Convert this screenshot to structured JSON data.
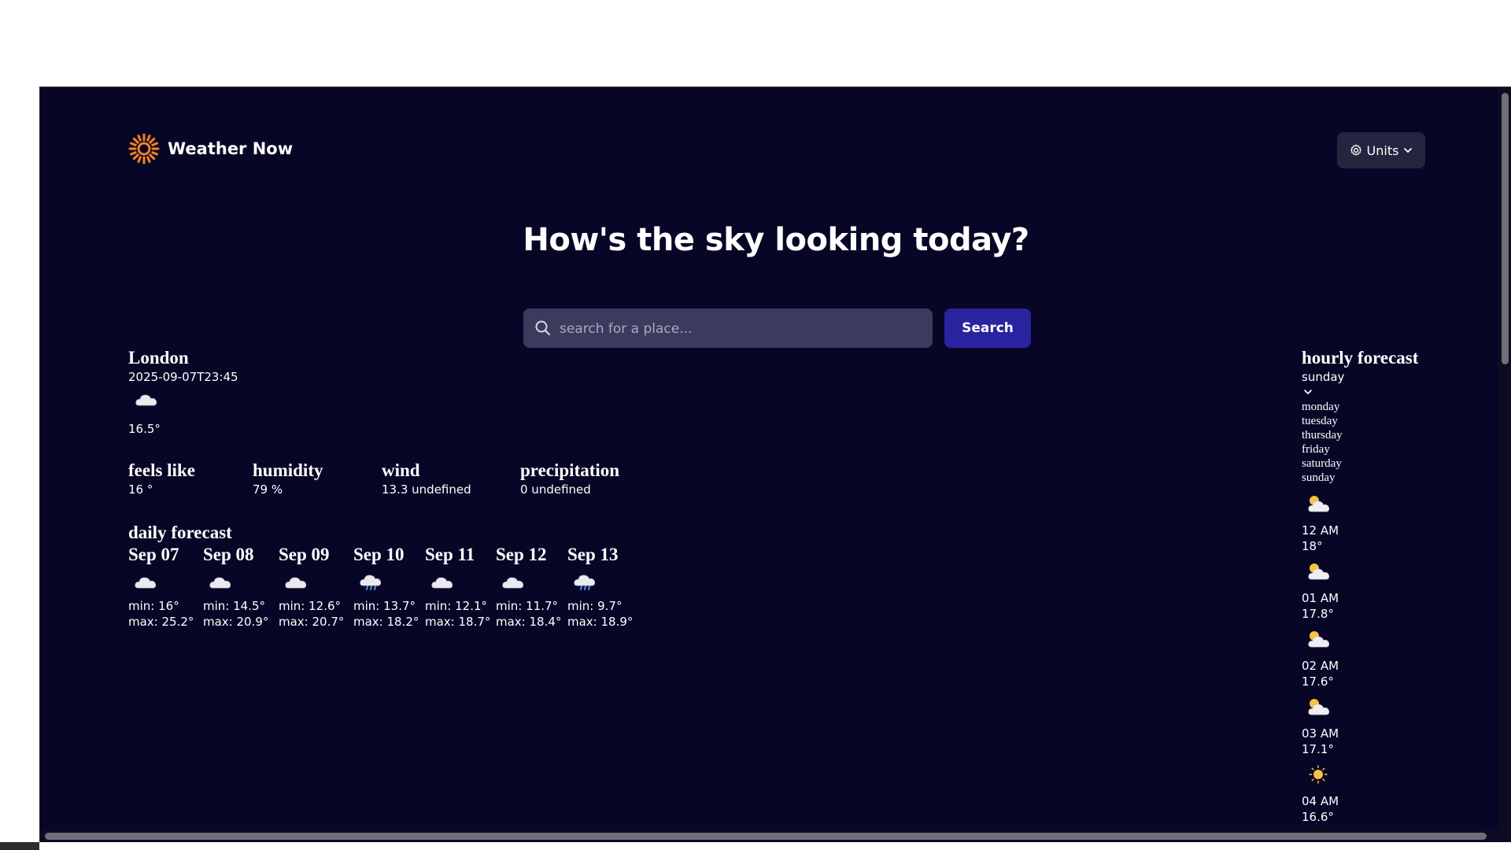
{
  "app": {
    "title": "Weather Now",
    "units_label": "Units",
    "headline": "How's the sky looking today?"
  },
  "search": {
    "placeholder": "search for a place...",
    "value": "",
    "button_label": "Search"
  },
  "current": {
    "city": "London",
    "datetime": "2025-09-07T23:45",
    "icon": "cloud-icon",
    "temperature": "16.5°"
  },
  "metrics": [
    {
      "label": "feels like",
      "value": "16 °"
    },
    {
      "label": "humidity",
      "value": "79 %"
    },
    {
      "label": "wind",
      "value": "13.3 undefined"
    },
    {
      "label": "precipitation",
      "value": "0 undefined"
    }
  ],
  "daily": {
    "title": "daily forecast",
    "days": [
      {
        "date": "Sep 07",
        "icon": "cloud-icon",
        "min": "min: 16°",
        "max": "max: 25.2°"
      },
      {
        "date": "Sep 08",
        "icon": "cloud-icon",
        "min": "min: 14.5°",
        "max": "max: 20.9°"
      },
      {
        "date": "Sep 09",
        "icon": "cloud-icon",
        "min": "min: 12.6°",
        "max": "max: 20.7°"
      },
      {
        "date": "Sep 10",
        "icon": "rain-cloud-icon",
        "min": "min: 13.7°",
        "max": "max: 18.2°"
      },
      {
        "date": "Sep 11",
        "icon": "cloud-icon",
        "min": "min: 12.1°",
        "max": "max: 18.7°"
      },
      {
        "date": "Sep 12",
        "icon": "cloud-icon",
        "min": "min: 11.7°",
        "max": "max: 18.4°"
      },
      {
        "date": "Sep 13",
        "icon": "rain-cloud-icon",
        "min": "min: 9.7°",
        "max": "max: 18.9°"
      }
    ]
  },
  "hourly": {
    "title": "hourly forecast",
    "selected_day": "sunday",
    "day_options": [
      "monday",
      "tuesday",
      "thursday",
      "friday",
      "saturday",
      "sunday"
    ],
    "hours": [
      {
        "time": "12 AM",
        "temp": "18°",
        "icon": "partly-cloudy-icon"
      },
      {
        "time": "01 AM",
        "temp": "17.8°",
        "icon": "partly-cloudy-icon"
      },
      {
        "time": "02 AM",
        "temp": "17.6°",
        "icon": "partly-cloudy-icon"
      },
      {
        "time": "03 AM",
        "temp": "17.1°",
        "icon": "partly-cloudy-icon"
      },
      {
        "time": "04 AM",
        "temp": "16.6°",
        "icon": "sun-icon"
      }
    ]
  },
  "colors": {
    "background": "#080626",
    "search_field": "#3c3b5e",
    "search_button": "#2a23a0",
    "units_button": "#25253f",
    "logo_orange": "#f5821f"
  }
}
